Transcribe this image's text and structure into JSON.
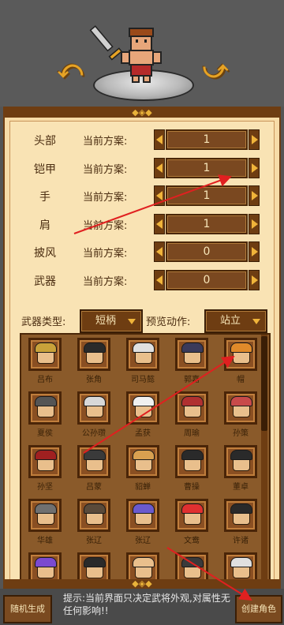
{
  "slots": [
    {
      "label": "头部",
      "scheme_label": "当前方案:",
      "value": "1"
    },
    {
      "label": "铠甲",
      "scheme_label": "当前方案:",
      "value": "1"
    },
    {
      "label": "手",
      "scheme_label": "当前方案:",
      "value": "1"
    },
    {
      "label": "肩",
      "scheme_label": "当前方案:",
      "value": "1"
    },
    {
      "label": "披风",
      "scheme_label": "当前方案:",
      "value": "0"
    },
    {
      "label": "武器",
      "scheme_label": "当前方案:",
      "value": "0"
    }
  ],
  "weapon_type": {
    "label": "武器类型:",
    "value": "短柄"
  },
  "preview_action": {
    "label": "预览动作:",
    "value": "站立"
  },
  "portraits": [
    {
      "name": "吕布",
      "helm": "#c9a23a"
    },
    {
      "name": "张角",
      "helm": "#2a2a2a"
    },
    {
      "name": "司马懿",
      "helm": "#e0e0e0"
    },
    {
      "name": "郭嘉",
      "helm": "#3a3a5a"
    },
    {
      "name": "帽",
      "helm": "#e08a2a"
    },
    {
      "name": "夏侯",
      "helm": "#555555"
    },
    {
      "name": "公孙瓒",
      "helm": "#d8d8d8"
    },
    {
      "name": "孟获",
      "helm": "#f0f0f0"
    },
    {
      "name": "周瑜",
      "helm": "#b03030"
    },
    {
      "name": "孙策",
      "helm": "#c84a4a"
    },
    {
      "name": "孙坚",
      "helm": "#a02020"
    },
    {
      "name": "吕蒙",
      "helm": "#3a3a3a"
    },
    {
      "name": "貂蝉",
      "helm": "#d8a050"
    },
    {
      "name": "曹操",
      "helm": "#2a2a2a"
    },
    {
      "name": "董卓",
      "helm": "#2a2a2a"
    },
    {
      "name": "华雄",
      "helm": "#707070"
    },
    {
      "name": "张辽",
      "helm": "#5a4a3a"
    },
    {
      "name": "张辽",
      "helm": "#6a5acd"
    },
    {
      "name": "文鸯",
      "helm": "#e03030"
    },
    {
      "name": "许诸",
      "helm": "#2a2a2a"
    },
    {
      "name": "",
      "helm": "#7a4ad0"
    },
    {
      "name": "",
      "helm": "#2a2a2a"
    },
    {
      "name": "",
      "helm": "#e9bf8c"
    },
    {
      "name": "",
      "helm": "#3a3a3a"
    },
    {
      "name": "",
      "helm": "#e0e0e0"
    }
  ],
  "bottom": {
    "random_button": "随机生成",
    "hint": "提示:当前界面只决定武将外观,对属性无任何影响!!",
    "create_button": "创建角色"
  },
  "colors": {
    "panel": "#f7dca8",
    "wood": "#6e3d12",
    "accent": "#f0b43a",
    "annotation": "#e02020"
  }
}
